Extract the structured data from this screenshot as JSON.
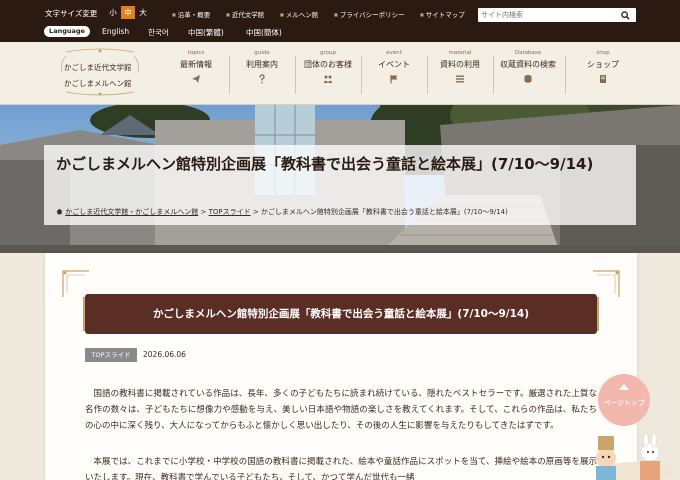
{
  "topbar": {
    "font_size_label": "文字サイズ変更",
    "font_sizes": [
      "小",
      "中",
      "大"
    ],
    "links": [
      "沿革・概要",
      "近代文学館",
      "メルヘン館",
      "プライバシーポリシー",
      "サイトマップ"
    ],
    "search_placeholder": "サイト内検索",
    "language_label": "Language",
    "languages": [
      "English",
      "한국어",
      "中国(繁體)",
      "中国(簡体)"
    ]
  },
  "logo": {
    "line1": "かごしま近代文学館",
    "line2": "かごしまメルヘン館"
  },
  "nav": [
    {
      "en": "topics",
      "jp": "最新情報",
      "icon": "paper-plane-icon"
    },
    {
      "en": "guide",
      "jp": "利用案内",
      "icon": "question-icon"
    },
    {
      "en": "group",
      "jp": "団体のお客様",
      "icon": "group-icon"
    },
    {
      "en": "event",
      "jp": "イベント",
      "icon": "flag-icon"
    },
    {
      "en": "material",
      "jp": "資料の利用",
      "icon": "list-icon"
    },
    {
      "en": "Database",
      "jp": "収蔵資料の検索",
      "icon": "database-icon"
    },
    {
      "en": "shop",
      "jp": "ショップ",
      "icon": "book-icon"
    }
  ],
  "hero": {
    "title": "かごしまメルヘン館特別企画展「教科書で出会う童話と絵本展」(7/10〜9/14)",
    "breadcrumb": {
      "home": "かごしま近代文学館・かごしまメルヘン館",
      "sep": ">",
      "section": "TOPスライド",
      "current": "かごしまメルヘン館特別企画展「教科書で出会う童話と絵本展」(7/10〜9/14)"
    }
  },
  "article": {
    "heading": "かごしまメルヘン館特別企画展「教科書で出会う童話と絵本展」(7/10〜9/14)",
    "tag": "TOPスライド",
    "date": "2026.06.06",
    "paragraph1": "国語の教科書に掲載されている作品は、長年、多くの子どもたちに読まれ続けている、隠れたベストセラーです。厳選された上質な名作の数々は、子どもたちに想像力や感動を与え、美しい日本語や物語の楽しさを教えてくれます。そして、これらの作品は、私たちの心の中に深く残り、大人になってからもふと懐かしく思い出したり、その後の人生に影響を与えたりもしてきたはずです。",
    "paragraph2": "本展では、これまでに小学校・中学校の国語の教科書に掲載された、絵本や童話作品にスポットを当て、挿絵や絵本の原画等を展示いたします。現在、教科書で学んでいる子どもたち、そして、かつて学んだ世代も一緒"
  },
  "pagetop_label": "ページトップ",
  "colors": {
    "topbar": "#2b1a12",
    "accent_orange": "#e0801e",
    "banner": "#5a2d25",
    "pagetop": "#f2b8ad"
  }
}
